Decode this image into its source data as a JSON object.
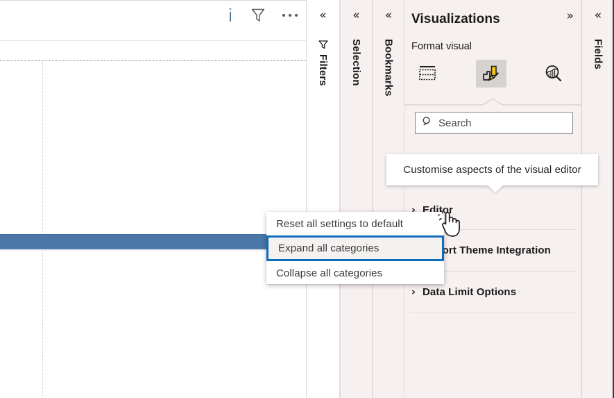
{
  "canvas": {
    "header_icons": [
      {
        "name": "info-icon",
        "title": "Information"
      },
      {
        "name": "filter-icon",
        "title": "Filters"
      },
      {
        "name": "more-options-icon",
        "title": "More options"
      }
    ],
    "highlight_bar_color": "#4a77a8"
  },
  "panel_tabs": [
    {
      "key": "filters",
      "label": "Filters",
      "chevron": "«",
      "icon": "filter-funnel-icon"
    },
    {
      "key": "selection",
      "label": "Selection",
      "chevron": "«"
    },
    {
      "key": "bookmarks",
      "label": "Bookmarks",
      "chevron": "«"
    },
    {
      "key": "fields",
      "label": "Fields",
      "chevron": "«"
    }
  ],
  "visualizations": {
    "title": "Visualizations",
    "expand_chevron": "»",
    "subtitle": "Format visual",
    "icon_buttons": [
      {
        "name": "build-visual-icon",
        "label": "Build visual",
        "selected": false
      },
      {
        "name": "format-visual-icon",
        "label": "Format visual",
        "selected": true
      },
      {
        "name": "analytics-visual-icon",
        "label": "Analytics",
        "selected": false
      }
    ],
    "search": {
      "placeholder": "Search",
      "value": "",
      "icon": "search-icon"
    },
    "sections": [
      {
        "key": "editor",
        "caret": "›",
        "label": "Editor",
        "expanded": false
      },
      {
        "key": "theme",
        "caret": "›",
        "label": "Report Theme Integration",
        "expanded": false
      },
      {
        "key": "limit",
        "caret": "›",
        "label": "Data Limit Options",
        "expanded": false
      }
    ]
  },
  "tooltip": {
    "text": "Customise aspects of the visual editor"
  },
  "context_menu": {
    "items": [
      {
        "key": "reset",
        "label": "Reset all settings to default",
        "highlighted": false
      },
      {
        "key": "expand",
        "label": "Expand all categories",
        "highlighted": true
      },
      {
        "key": "collapse",
        "label": "Collapse all categories",
        "highlighted": false
      }
    ],
    "highlight_border_color": "#0f6cbd"
  },
  "cursor": {
    "type": "pointer-hand-cursor"
  }
}
